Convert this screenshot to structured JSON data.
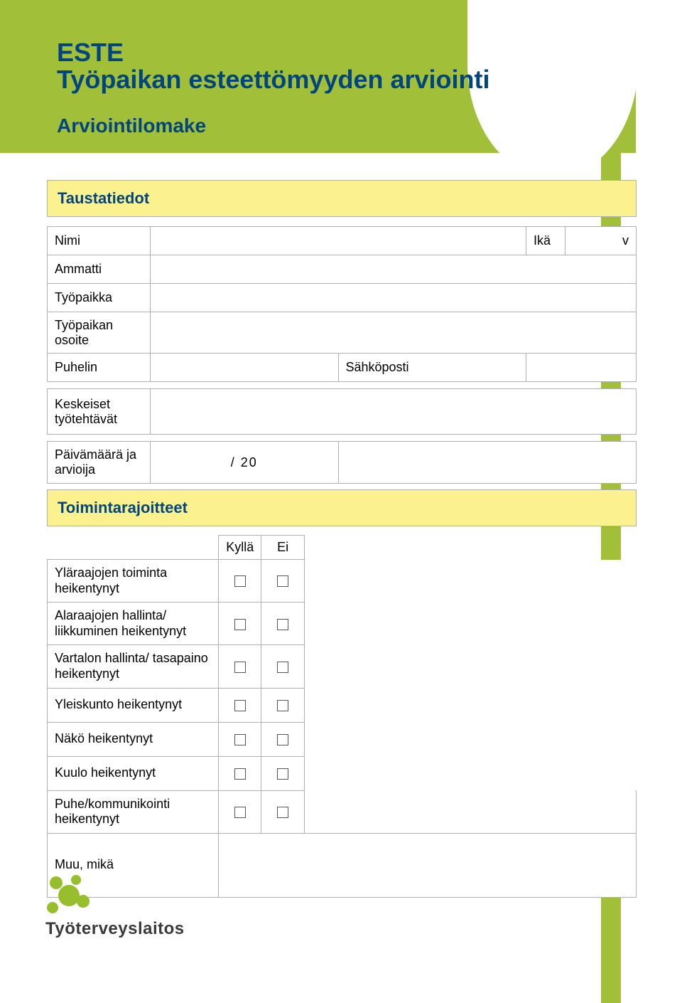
{
  "header": {
    "title_line1": "ESTE",
    "title_line2": "Työpaikan esteettömyyden arviointi",
    "subtitle": "Arviointilomake"
  },
  "sections": {
    "background": "Taustatiedot",
    "limitations": "Toimintarajoitteet"
  },
  "bg_fields": {
    "name": "Nimi",
    "age": "Ikä",
    "age_unit": "v",
    "occupation": "Ammatti",
    "workplace": "Työpaikka",
    "workplace_addr": "Työpaikan osoite",
    "phone": "Puhelin",
    "email": "Sähköposti",
    "tasks": "Keskeiset työtehtävät",
    "date_assessor": "Päivämäärä ja arvioija",
    "date_value": "/     20"
  },
  "lim_headers": {
    "yes": "Kyllä",
    "no": "Ei"
  },
  "lim_rows": [
    {
      "label": "Yläraajojen toiminta heikentynyt"
    },
    {
      "label": "Alaraajojen hallinta/ liikkuminen heikentynyt"
    },
    {
      "label": "Vartalon hallinta/ tasapaino heikentynyt"
    },
    {
      "label": "Yleiskunto heikentynyt"
    },
    {
      "label": "Näkö heikentynyt"
    },
    {
      "label": "Kuulo heikentynyt"
    },
    {
      "label": "Puhe/kommunikointi heikentynyt"
    }
  ],
  "lim_other": "Muu, mikä",
  "footer": {
    "org": "Työterveyslaitos"
  }
}
